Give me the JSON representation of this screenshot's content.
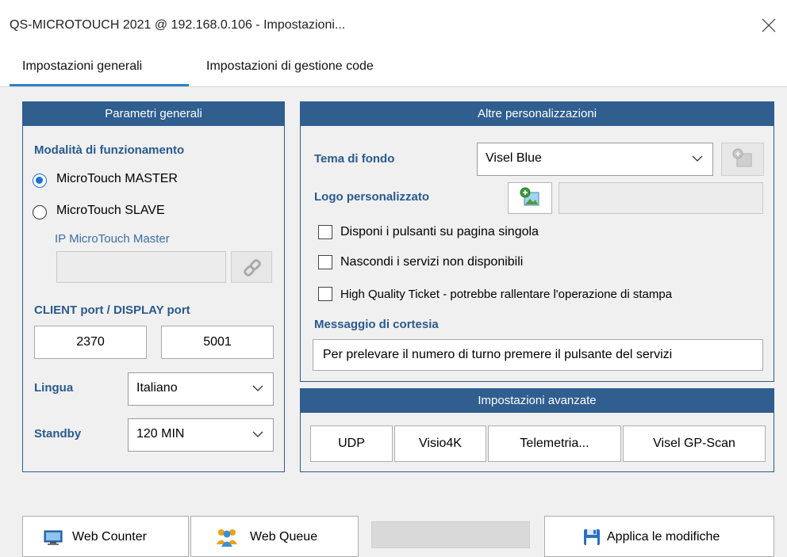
{
  "window": {
    "title": "QS-MICROTOUCH 2021 @ 192.168.0.106 - Impostazioni...",
    "close_icon": "close-icon"
  },
  "tabs": [
    {
      "label": "Impostazioni generali",
      "active": true
    },
    {
      "label": "Impostazioni di gestione code",
      "active": false
    }
  ],
  "general_params": {
    "header": "Parametri generali",
    "mode_label": "Modalità di funzionamento",
    "options": [
      {
        "label": "MicroTouch MASTER",
        "selected": true
      },
      {
        "label": "MicroTouch SLAVE",
        "selected": false
      }
    ],
    "ip_label": "IP MicroTouch Master",
    "ip_value": "",
    "ports_label": "CLIENT port / DISPLAY port",
    "client_port": "2370",
    "display_port": "5001",
    "language_label": "Lingua",
    "language_value": "Italiano",
    "standby_label": "Standby",
    "standby_value": "120 MIN"
  },
  "customizations": {
    "header": "Altre personalizzazioni",
    "theme_label": "Tema di fondo",
    "theme_value": "Visel Blue",
    "logo_label": "Logo personalizzato",
    "logo_value": "",
    "checkboxes": [
      {
        "label": "Disponi i pulsanti su pagina singola",
        "checked": false
      },
      {
        "label": "Nascondi i servizi non disponibili",
        "checked": false
      },
      {
        "label": "High Quality Ticket - potrebbe rallentare l'operazione di stampa",
        "checked": false
      }
    ],
    "courtesy_label": "Messaggio di cortesia",
    "courtesy_value": "Per prelevare il numero di turno premere il pulsante del servizi"
  },
  "advanced": {
    "header": "Impostazioni avanzate",
    "buttons": [
      "UDP",
      "Visio4K",
      "Telemetria...",
      "Visel GP-Scan"
    ]
  },
  "footer": {
    "web_counter": "Web Counter",
    "web_queue": "Web Queue",
    "apply": "Applica le modifiche",
    "progress": 0
  },
  "colors": {
    "panel_header": "#2f5e8f",
    "label_blue": "#2a5a8e",
    "tab_underline": "#2f7fc9",
    "radio_selected": "#1a73d0"
  }
}
